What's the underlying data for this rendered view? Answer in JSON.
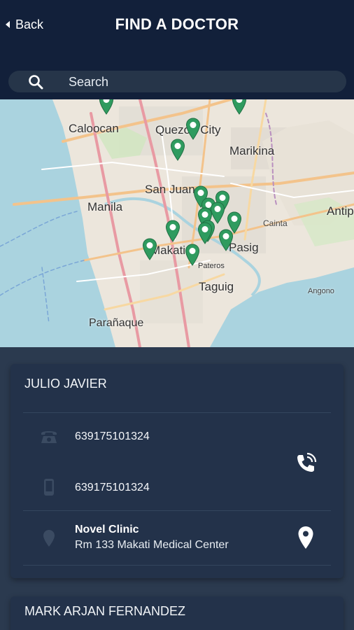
{
  "header": {
    "back_label": "Back",
    "title": "FIND A DOCTOR"
  },
  "search": {
    "placeholder": "Search"
  },
  "map": {
    "place_labels": [
      "Caloocan",
      "Quezon City",
      "Marikina",
      "San Juan",
      "Manila",
      "Makati",
      "Pasig",
      "Pateros",
      "Taguig",
      "Parañaque",
      "Cainta",
      "Antip",
      "Angono"
    ],
    "pin_color": "#2f9b5f"
  },
  "doctors": [
    {
      "name": "JULIO JAVIER",
      "phone": "639175101324",
      "mobile": "639175101324",
      "clinic_name": "Novel Clinic",
      "clinic_address": "Rm 133 Makati Medical Center"
    },
    {
      "name": "MARK ARJAN FERNANDEZ"
    }
  ],
  "icons": {
    "back": "chevron-left-icon",
    "search": "search-icon",
    "phone": "telephone-icon",
    "mobile": "mobile-phone-icon",
    "location": "location-pin-icon",
    "call": "phone-call-icon",
    "map_marker": "map-marker-icon"
  }
}
